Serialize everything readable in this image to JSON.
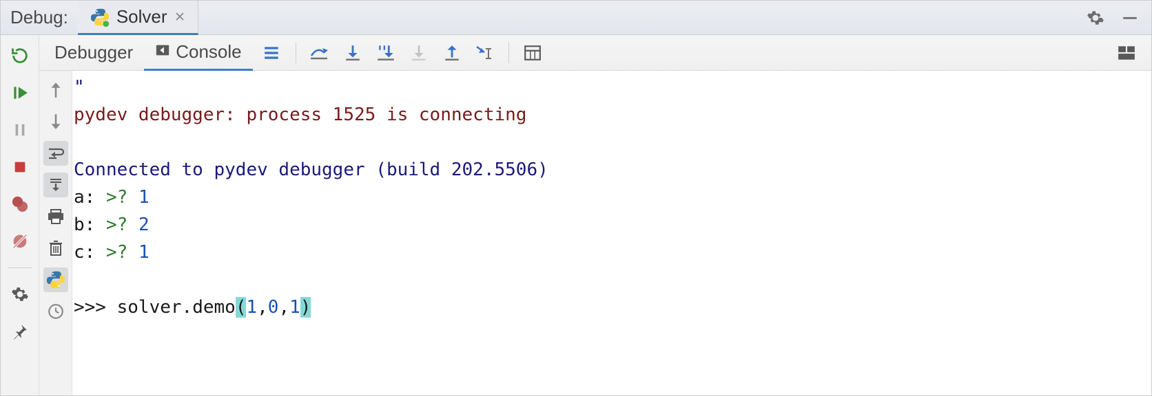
{
  "title": "Debug:",
  "tab": {
    "label": "Solver"
  },
  "toolbar": {
    "debugger_label": "Debugger",
    "console_label": "Console"
  },
  "console": {
    "quote": "\"",
    "line_connecting": "pydev debugger: process 1525 is connecting",
    "blank": "",
    "line_connected": "Connected to pydev debugger (build 202.5506)",
    "a_label": "a:",
    "a_prompt": ">?",
    "a_val": "1",
    "b_label": "b:",
    "b_prompt": ">?",
    "b_val": "2",
    "c_label": "c:",
    "c_prompt": ">?",
    "c_val": "1",
    "cmd_prompt": ">>>",
    "cmd_text_pre": "solver.demo",
    "cmd_paren_open": "(",
    "cmd_arg1": "1",
    "cmd_comma1": ",",
    "cmd_arg2": "0",
    "cmd_comma2": ",",
    "cmd_arg3": "1",
    "cmd_paren_close": ")"
  }
}
